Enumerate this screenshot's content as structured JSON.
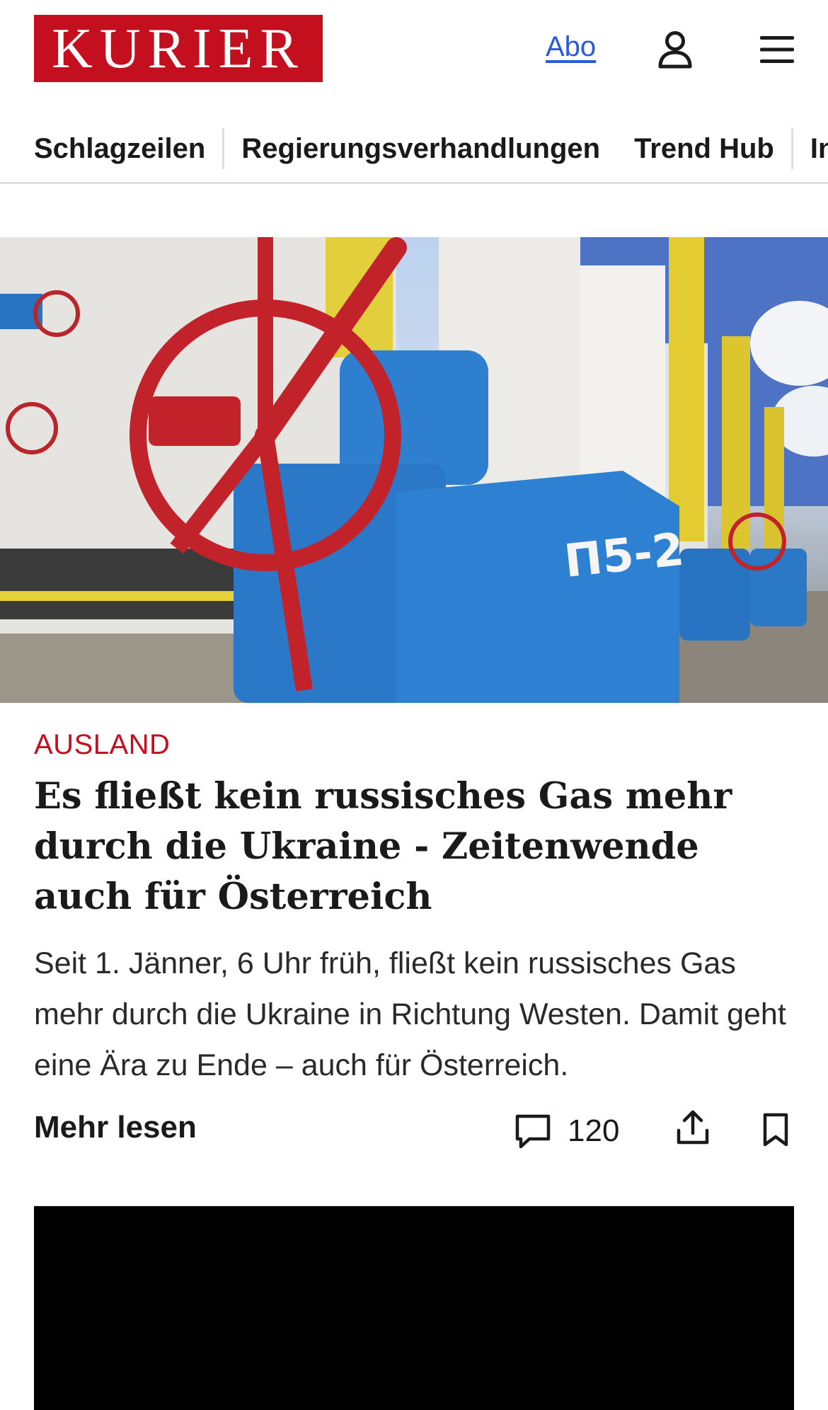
{
  "header": {
    "logo_text": "KURIER",
    "abo_label": "Abo",
    "user_icon": "user-icon",
    "menu_icon": "hamburger-menu-icon"
  },
  "nav": {
    "items": [
      "Schlagzeilen",
      "Regierungsverhandlungen",
      "Trend Hub",
      "In"
    ]
  },
  "article": {
    "image": "Blue and yellow gas pipeline valves with a red valve wheel",
    "image_marking": "П5-2",
    "category": "AUSLAND",
    "headline": "Es fließt kein russisches Gas mehr durch die Ukraine - Zeitenwende auch für Österreich",
    "teaser": "Seit 1. Jänner, 6 Uhr früh, fließt kein russisches Gas mehr durch die Ukraine in Richtung Westen. Damit geht eine Ära zu Ende – auch für Österreich.",
    "more_label": "Mehr lesen",
    "comment_count": "120",
    "icons": [
      "comment-icon",
      "share-icon",
      "bookmark-icon"
    ]
  },
  "colors": {
    "brand_red": "#c4101e",
    "link_blue": "#2a5bd7",
    "divider": "#dedede"
  }
}
